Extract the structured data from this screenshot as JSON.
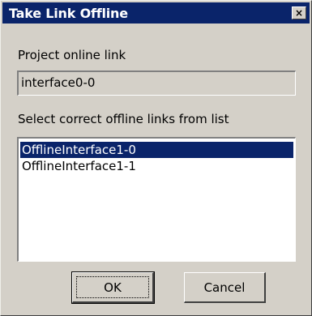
{
  "window": {
    "title": "Take Link Offline",
    "close_glyph": "×"
  },
  "online_link": {
    "label": "Project online link",
    "value": "interface0-0"
  },
  "offline_links": {
    "label": "Select correct offline links from list",
    "items": [
      {
        "label": "OfflineInterface1-0",
        "selected": true
      },
      {
        "label": "OfflineInterface1-1",
        "selected": false
      }
    ]
  },
  "buttons": {
    "ok": "OK",
    "cancel": "Cancel"
  },
  "colors": {
    "titlebar": "#0a246a",
    "face": "#d4d0c8",
    "selection": "#0a246a"
  }
}
